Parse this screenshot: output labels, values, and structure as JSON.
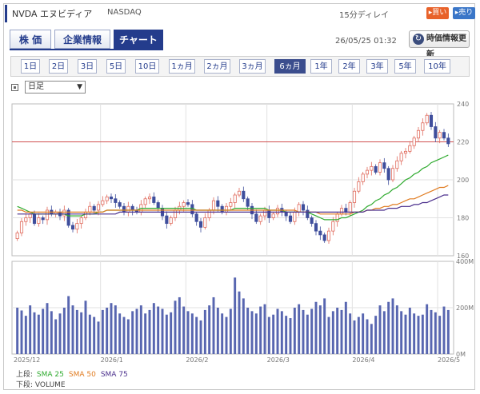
{
  "header": {
    "title": "NVDA エヌビディア",
    "exchange": "NASDAQ",
    "delay": "15分ディレイ",
    "buy_label": "買い",
    "sell_label": "売り"
  },
  "tabs": [
    {
      "label": "株 価",
      "active": false
    },
    {
      "label": "企業情報",
      "active": false
    },
    {
      "label": "チャート",
      "active": true
    }
  ],
  "datetime": "26/05/25 01:32",
  "refresh_label": "時価情報更新",
  "periods": [
    {
      "label": "1日",
      "active": false
    },
    {
      "label": "2日",
      "active": false
    },
    {
      "label": "3日",
      "active": false
    },
    {
      "label": "5日",
      "active": false
    },
    {
      "label": "10日",
      "active": false
    },
    {
      "label": "1ヵ月",
      "active": false
    },
    {
      "label": "2ヵ月",
      "active": false
    },
    {
      "label": "3ヵ月",
      "active": false
    },
    {
      "label": "6ヵ月",
      "active": true
    },
    {
      "label": "1年",
      "active": false
    },
    {
      "label": "2年",
      "active": false
    },
    {
      "label": "3年",
      "active": false
    },
    {
      "label": "5年",
      "active": false
    },
    {
      "label": "10年",
      "active": false
    }
  ],
  "select": {
    "value": "日足"
  },
  "legend": {
    "upper_label": "上段:",
    "lower_label": "下段:",
    "lower_value": "VOLUME",
    "sma": [
      {
        "name": "SMA 25",
        "color": "#2eaa2e"
      },
      {
        "name": "SMA 50",
        "color": "#e07b20"
      },
      {
        "name": "SMA 75",
        "color": "#4a2f8c"
      }
    ]
  },
  "colors": {
    "up": "#e06a5c",
    "down": "#3f4e9c",
    "volume": "#5866b0",
    "refline": "#d05050"
  },
  "chart_data": {
    "type": "candlestick",
    "price_ylim": [
      160,
      240
    ],
    "price_ticks": [
      "240",
      "220",
      "200",
      "180",
      "160"
    ],
    "volume_ylim": [
      0,
      400
    ],
    "volume_ticks": [
      "400M",
      "200M",
      "0M"
    ],
    "x_ticks": [
      "2025/12",
      "2026/1",
      "2026/2",
      "2026/3",
      "2026/4",
      "2026/5"
    ],
    "reference_line": 220,
    "close": [
      172,
      178,
      180,
      182,
      177,
      180,
      179,
      184,
      182,
      183,
      181,
      184,
      176,
      174,
      177,
      180,
      183,
      186,
      184,
      187,
      189,
      191,
      190,
      188,
      186,
      183,
      186,
      184,
      183,
      187,
      190,
      191,
      188,
      185,
      181,
      177,
      180,
      184,
      186,
      188,
      187,
      182,
      178,
      175,
      180,
      184,
      189,
      186,
      183,
      186,
      188,
      192,
      194,
      190,
      186,
      182,
      178,
      181,
      184,
      180,
      182,
      185,
      183,
      181,
      178,
      183,
      187,
      184,
      180,
      177,
      173,
      171,
      168,
      173,
      178,
      182,
      185,
      183,
      188,
      194,
      199,
      203,
      205,
      207,
      204,
      209,
      206,
      200,
      206,
      210,
      214,
      215,
      218,
      222,
      226,
      230,
      234,
      228,
      222,
      225,
      222,
      219
    ],
    "sma25": [
      186,
      185,
      184,
      183,
      182,
      182,
      182,
      182,
      182,
      182,
      182,
      182,
      181,
      181,
      181,
      181,
      182,
      182,
      182,
      183,
      183,
      184,
      184,
      184,
      184,
      184,
      184,
      184,
      184,
      185,
      185,
      185,
      185,
      185,
      185,
      185,
      185,
      185,
      185,
      185,
      185,
      185,
      184,
      184,
      184,
      184,
      184,
      184,
      184,
      184,
      184,
      185,
      185,
      185,
      185,
      185,
      185,
      185,
      185,
      184,
      184,
      184,
      184,
      183,
      183,
      183,
      183,
      183,
      183,
      182,
      181,
      180,
      179,
      179,
      179,
      179,
      180,
      180,
      181,
      182,
      183,
      184,
      186,
      187,
      189,
      190,
      192,
      193,
      195,
      196,
      198,
      200,
      201,
      203,
      204,
      206,
      207,
      209,
      210,
      211,
      212,
      213
    ],
    "sma50": [
      184,
      184,
      183,
      183,
      183,
      183,
      183,
      183,
      183,
      183,
      183,
      183,
      183,
      183,
      183,
      183,
      183,
      183,
      183,
      183,
      183,
      184,
      184,
      184,
      184,
      184,
      184,
      184,
      184,
      184,
      184,
      184,
      184,
      184,
      184,
      184,
      184,
      184,
      184,
      184,
      184,
      184,
      184,
      184,
      184,
      184,
      184,
      184,
      184,
      184,
      184,
      184,
      184,
      184,
      184,
      184,
      184,
      184,
      184,
      184,
      184,
      184,
      184,
      184,
      184,
      184,
      183,
      183,
      183,
      183,
      183,
      182,
      182,
      182,
      182,
      182,
      182,
      182,
      182,
      183,
      183,
      183,
      184,
      184,
      185,
      185,
      186,
      186,
      187,
      187,
      188,
      189,
      190,
      190,
      191,
      192,
      193,
      194,
      195,
      196,
      196,
      197
    ],
    "sma75": [
      182,
      182,
      182,
      182,
      182,
      182,
      182,
      182,
      182,
      182,
      182,
      182,
      182,
      182,
      182,
      182,
      182,
      182,
      182,
      182,
      182,
      182,
      182,
      182,
      183,
      183,
      183,
      183,
      183,
      183,
      183,
      183,
      183,
      183,
      183,
      183,
      183,
      183,
      183,
      183,
      183,
      183,
      183,
      183,
      183,
      183,
      183,
      183,
      183,
      183,
      183,
      183,
      183,
      183,
      183,
      183,
      183,
      183,
      183,
      183,
      183,
      183,
      183,
      183,
      183,
      183,
      183,
      183,
      183,
      183,
      183,
      183,
      183,
      183,
      183,
      183,
      183,
      183,
      183,
      183,
      183,
      183,
      184,
      184,
      184,
      184,
      184,
      185,
      185,
      185,
      186,
      186,
      186,
      187,
      187,
      188,
      188,
      189,
      190,
      191,
      192,
      192
    ],
    "volume": [
      200,
      188,
      165,
      210,
      180,
      170,
      195,
      220,
      185,
      150,
      175,
      200,
      250,
      210,
      190,
      180,
      230,
      170,
      160,
      140,
      190,
      200,
      220,
      210,
      175,
      160,
      150,
      185,
      195,
      210,
      175,
      190,
      220,
      205,
      195,
      170,
      180,
      230,
      245,
      205,
      185,
      175,
      160,
      145,
      190,
      210,
      245,
      200,
      175,
      160,
      195,
      330,
      270,
      240,
      200,
      185,
      175,
      205,
      215,
      160,
      170,
      195,
      185,
      165,
      155,
      200,
      215,
      190,
      170,
      195,
      225,
      210,
      240,
      160,
      185,
      200,
      190,
      225,
      175,
      145,
      160,
      175,
      150,
      130,
      165,
      210,
      185,
      225,
      240,
      210,
      185,
      170,
      200,
      175,
      165,
      170,
      215,
      190,
      180,
      165,
      205,
      190
    ]
  }
}
